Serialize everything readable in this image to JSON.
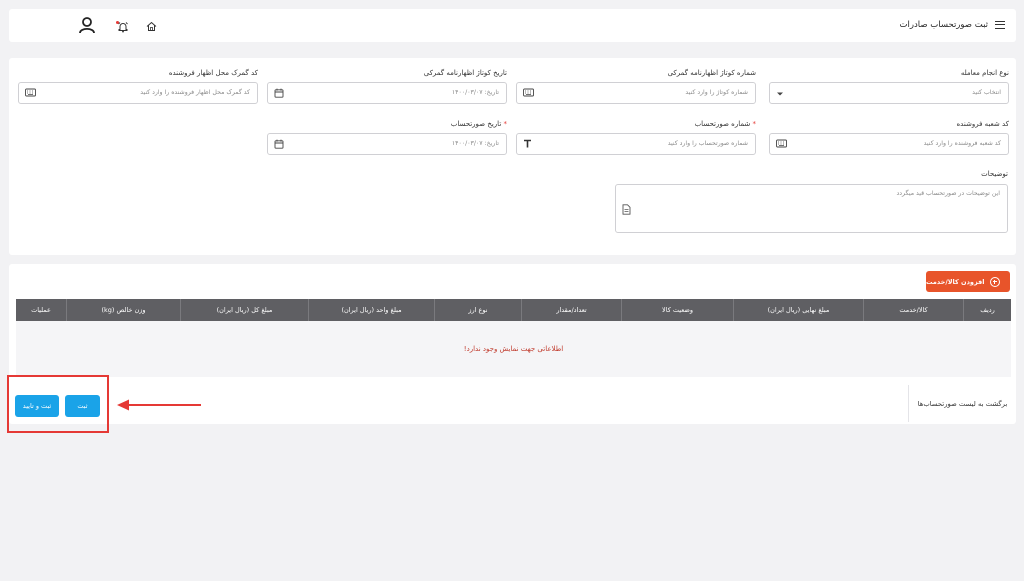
{
  "header": {
    "title": "ثبت صورتحساب صادرات"
  },
  "form": {
    "transaction_type": {
      "label": "نوع انجام معامله",
      "placeholder": "انتخاب کنید"
    },
    "declaration_no": {
      "label": "شماره کوتاژ اظهارنامه گمرکی",
      "placeholder": "شماره کوتاژ را وارد کنید"
    },
    "declaration_date": {
      "label": "تاریخ کوتاژ اظهارنامه گمرکی",
      "placeholder": "تاریخ: ۱۴۰۰/۰۳/۰۷"
    },
    "customs_code": {
      "label": "کد گمرک محل اظهار فروشنده",
      "placeholder": "کد گمرک محل اظهار فروشنده را وارد کنید"
    },
    "branch_code": {
      "label": "کد شعبه فروشنده",
      "placeholder": "کد شعبه فروشنده را وارد کنید"
    },
    "invoice_no": {
      "label": "شماره صورتحساب",
      "placeholder": "شماره صورتحساب را وارد کنید"
    },
    "invoice_date": {
      "label": "تاریخ صورتحساب",
      "placeholder": "تاریخ: ۱۴۰۰/۰۳/۰۷"
    },
    "required_mark": "*",
    "description": {
      "label": "توضیحات",
      "placeholder": "این توضیحات در صورتحساب قید میگردد"
    }
  },
  "items": {
    "add_label": "افزودن کالا/خدمت",
    "columns": [
      "ردیف",
      "کالا/خدمت",
      "مبلغ نهایی (ریال ایران)",
      "وضعیت کالا",
      "تعداد/مقدار",
      "نوع ارز",
      "مبلغ واحد (ریال ایران)",
      "مبلغ کل (ریال ایران)",
      "وزن خالص (kg)",
      "عملیات"
    ],
    "empty_message": "اطلاعاتی جهت نمایش وجود ندارد!"
  },
  "actions": {
    "back_label": "برگشت به لیست صورتحساب‌ها",
    "submit_label": "ثبت",
    "submit_confirm_label": "ثبت و تایید"
  },
  "colors": {
    "accent_orange": "#e8542a",
    "primary_blue": "#1aa3e8",
    "table_header": "#5f5f63",
    "annotation_red": "#e53935"
  }
}
